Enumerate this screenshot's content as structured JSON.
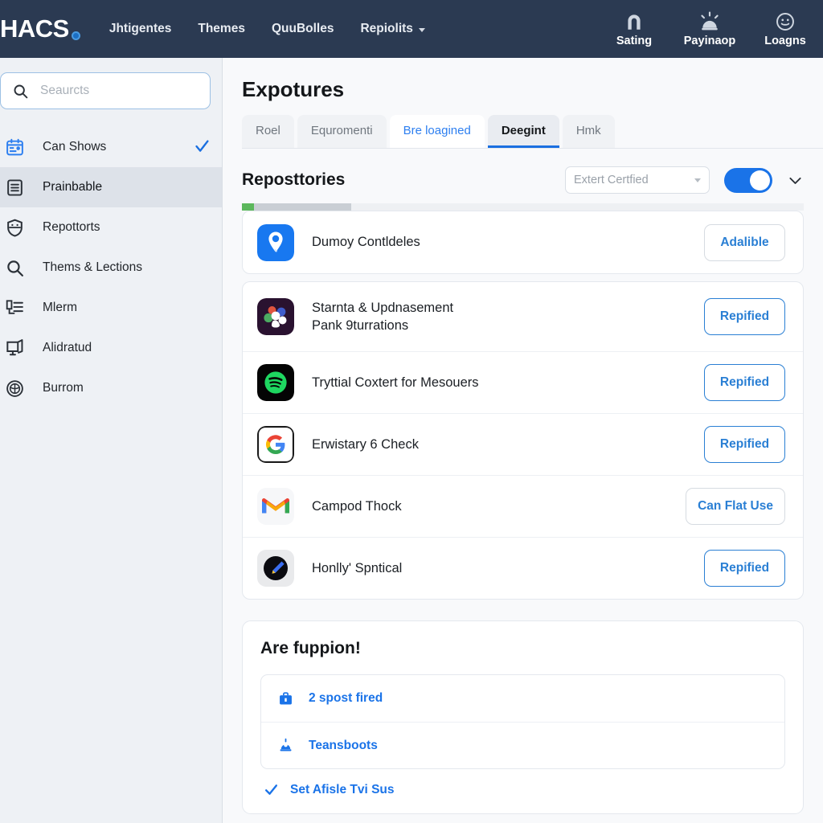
{
  "topnav": {
    "brand": "HACS",
    "links": [
      {
        "label": "Jhtigentes",
        "caret": false
      },
      {
        "label": "Themes",
        "caret": false
      },
      {
        "label": "QuuBolles",
        "caret": false
      },
      {
        "label": "Repiolits",
        "caret": true
      }
    ],
    "actions": [
      {
        "label": "Sating",
        "icon": "arch-icon"
      },
      {
        "label": "Payinaop",
        "icon": "alarm-dome-icon"
      },
      {
        "label": "Loagns",
        "icon": "smiley-circle-icon"
      }
    ],
    "bg_color": "#2b3a52"
  },
  "sidebar": {
    "search": {
      "placeholder": "Seaurcts",
      "value": "",
      "icon": "search-icon"
    },
    "items": [
      {
        "label": "Can Shows",
        "icon": "calendar-board-icon",
        "active": false,
        "check": true
      },
      {
        "label": "Prainbable",
        "icon": "document-lines-icon",
        "active": true,
        "check": false
      },
      {
        "label": "Repottorts",
        "icon": "shield-icon",
        "active": false,
        "check": false
      },
      {
        "label": "Thems & Lections",
        "icon": "search-icon",
        "active": false,
        "check": false
      },
      {
        "label": "Mlerm",
        "icon": "list-indent-icon",
        "active": false,
        "check": false
      },
      {
        "label": "Alidratud",
        "icon": "monitor-icon",
        "active": false,
        "check": false
      },
      {
        "label": "Burrom",
        "icon": "globe-circle-icon",
        "active": false,
        "check": false
      }
    ]
  },
  "main": {
    "page_title": "Expotures",
    "tabs": [
      {
        "label": "Roel",
        "state": "normal"
      },
      {
        "label": "Equromenti",
        "state": "normal"
      },
      {
        "label": "Bre loagined",
        "state": "light"
      },
      {
        "label": "Deegint",
        "state": "current"
      },
      {
        "label": "Hmk",
        "state": "normal"
      }
    ],
    "section": {
      "title": "Reposttories",
      "select_value": "Extert Certfied",
      "toggle_on": true,
      "chevron_icon": "chevron-down-icon",
      "progress_percent": 19
    },
    "repos": [
      {
        "name": "Dumoy Contldeles",
        "icon": "location-pin-icon",
        "button": "Adalible",
        "button_style": "muted",
        "separate": true
      },
      {
        "name": "Starnta & Updnasement\nPank 9turrations",
        "icon": "cluster-dots-icon",
        "button": "Repified",
        "button_style": "outline",
        "separate": false
      },
      {
        "name": "Tryttial Coxtert for Mesouers",
        "icon": "spotify-icon",
        "button": "Repified",
        "button_style": "outline",
        "separate": false
      },
      {
        "name": "Erwistary 6 Check",
        "icon": "google-g-icon",
        "button": "Repified",
        "button_style": "outline",
        "separate": false
      },
      {
        "name": "Campod Thock",
        "icon": "gmail-icon",
        "button": "Can Flat Use",
        "button_style": "muted",
        "separate": false
      },
      {
        "name": "Honlly' Spntical",
        "icon": "pen-dark-icon",
        "button": "Repified",
        "button_style": "outline",
        "separate": false
      }
    ],
    "bottom": {
      "title": "Are fuppion!",
      "items": [
        {
          "label": "2 spost fired",
          "icon": "briefcase-icon"
        },
        {
          "label": "Teansboots",
          "icon": "lamp-icon"
        }
      ],
      "footer": {
        "label": "Set Afisle Tvi Sus",
        "icon": "check-icon"
      }
    }
  },
  "colors": {
    "accent": "#1a73e8",
    "nav_bg": "#2b3a52",
    "link_blue": "#2a7fd4",
    "progress_green": "#5cb85c"
  }
}
